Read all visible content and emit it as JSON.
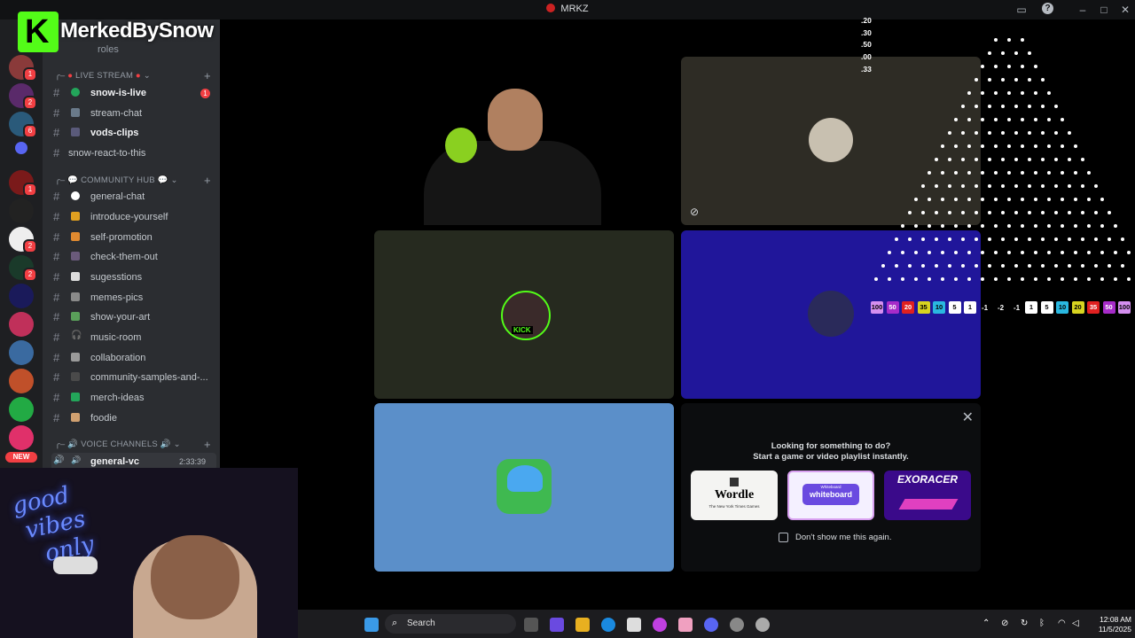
{
  "window": {
    "title": "MRKZ"
  },
  "overlay": {
    "streamer_name": "MerkedBySnow",
    "logo_letter": "K"
  },
  "servers": {
    "badges": [
      "1",
      "2",
      "6",
      "1",
      "2",
      "2"
    ],
    "new_label": "NEW"
  },
  "sidebar": {
    "partial_top": "roles",
    "categories": [
      {
        "label": "LIVE STREAM",
        "channels": [
          {
            "name": "snow-is-live",
            "unread": "1",
            "bold": true
          },
          {
            "name": "stream-chat"
          },
          {
            "name": "vods-clips",
            "bold": true
          },
          {
            "name": "snow-react-to-this"
          }
        ]
      },
      {
        "label": "COMMUNITY HUB",
        "channels": [
          {
            "name": "general-chat"
          },
          {
            "name": "introduce-yourself"
          },
          {
            "name": "self-promotion"
          },
          {
            "name": "check-them-out"
          },
          {
            "name": "sugesstions"
          },
          {
            "name": "memes-pics"
          },
          {
            "name": "show-your-art"
          },
          {
            "name": "music-room"
          },
          {
            "name": "collaboration"
          },
          {
            "name": "community-samples-and-..."
          },
          {
            "name": "merch-ideas"
          },
          {
            "name": "foodie"
          }
        ]
      },
      {
        "label": "VOICE CHANNELS",
        "channels": [
          {
            "name": "general-vc",
            "time": "2:33:39"
          }
        ]
      }
    ]
  },
  "stage": {
    "tiles": [
      {
        "name": "main-video",
        "bg": "#000000"
      },
      {
        "name": "tile-avatar-1",
        "bg": "#2e2c25"
      },
      {
        "name": "tile-avatar-2",
        "bg": "#262a1f"
      },
      {
        "name": "tile-avatar-3",
        "bg": "#20169a"
      },
      {
        "name": "tile-avatar-4",
        "bg": "#5b8fc9"
      }
    ],
    "avatar_badge": "KICK"
  },
  "activity": {
    "line1": "Looking for something to do?",
    "line2": "Start a game or video playlist instantly.",
    "cards": [
      {
        "title": "Wordle",
        "subtitle": "The New York Times Games"
      },
      {
        "title": "whiteboard",
        "subtitle": "Whiteboard"
      },
      {
        "title": "EXORACER",
        "subtitle": ""
      }
    ],
    "checkbox_label": "Don't show me this again."
  },
  "betting": {
    "odds": [
      ".20",
      ".30",
      ".50",
      ".00",
      ".33"
    ],
    "left_chips": [
      "100",
      "50",
      "20",
      "35",
      "10",
      "5",
      "1"
    ],
    "multipliers": [
      "-1",
      "-2",
      "-1"
    ],
    "right_chips": [
      "1",
      "5",
      "10",
      "20",
      "35",
      "50",
      "100"
    ],
    "chip_colors": [
      "#d58ff0",
      "#a62bc9",
      "#e02020",
      "#d8d420",
      "#2ab8e0",
      "#ffffff",
      "#ffffff"
    ]
  },
  "taskbar": {
    "search_label": "Search",
    "time": "12:08 AM",
    "date": "11/5/2025"
  }
}
